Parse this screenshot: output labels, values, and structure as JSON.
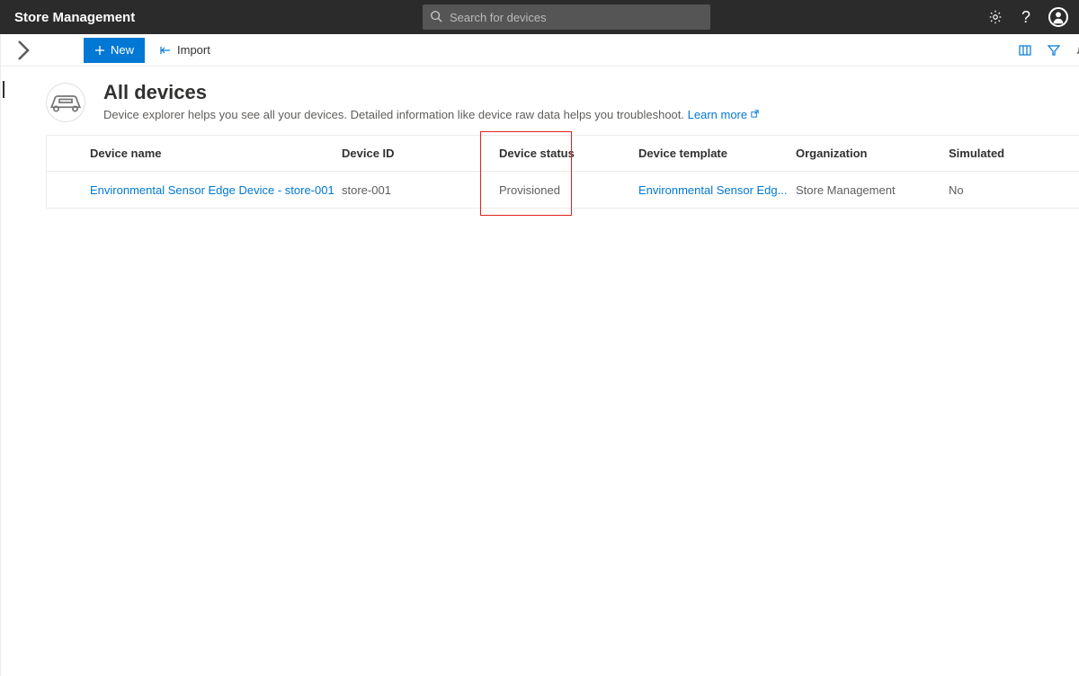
{
  "header": {
    "app_title": "Store Management",
    "search_placeholder": "Search for devices"
  },
  "toolbar": {
    "new_label": "New",
    "import_label": "Import"
  },
  "main": {
    "title": "All devices",
    "subtitle": "Device explorer helps you see all your devices. Detailed information like device raw data helps you troubleshoot. ",
    "learn_more": "Learn more"
  },
  "table": {
    "columns": {
      "device_name": "Device name",
      "device_id": "Device ID",
      "device_status": "Device status",
      "device_template": "Device template",
      "organization": "Organization",
      "simulated": "Simulated"
    },
    "rows": [
      {
        "device_name": "Environmental Sensor Edge Device - store-001",
        "device_id": "store-001",
        "device_status": "Provisioned",
        "device_template": "Environmental Sensor Edg...",
        "organization": "Store Management",
        "simulated": "No"
      }
    ]
  }
}
